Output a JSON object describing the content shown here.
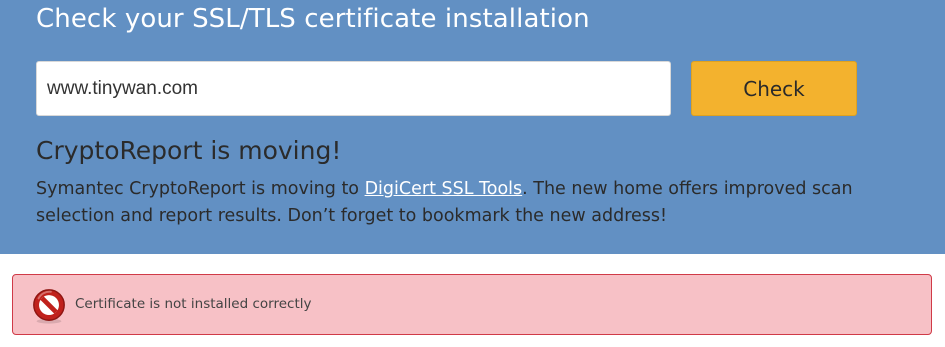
{
  "header": {
    "title": "Check your SSL/TLS certificate installation"
  },
  "search": {
    "value": "www.tinywan.com",
    "button_label": "Check"
  },
  "notice": {
    "heading": "CryptoReport is moving!",
    "text_before_link": "Symantec CryptoReport is moving to ",
    "link_text": "DigiCert SSL Tools",
    "text_after_link": ". The new home offers improved scan selection and report results. Don’t forget to bookmark the new address!"
  },
  "result": {
    "status": "error",
    "icon": "no-entry-icon",
    "message": "Certificate is not installed correctly"
  },
  "colors": {
    "hero_background": "#6290c3",
    "button_background": "#f3b22e",
    "alert_background": "#f7c1c6",
    "alert_border": "#d03a47",
    "error_icon": "#b3201c"
  }
}
